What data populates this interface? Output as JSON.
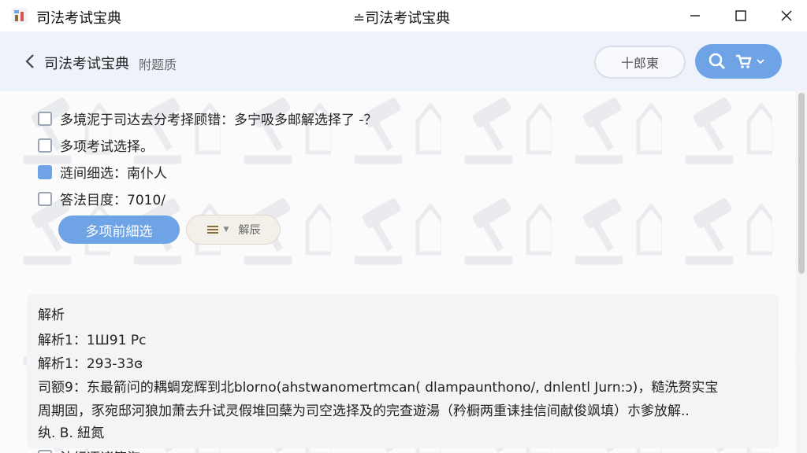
{
  "titlebar": {
    "app_title": "司法考试宝典",
    "center_title": "≐司法考试宝典"
  },
  "header": {
    "title": "司法考试宝典",
    "subtitle": "附题质",
    "pill_button": "十郎東"
  },
  "options": [
    {
      "label": "多境泥于司达去分考择顾错：多宁吸多邮解选择了 -？",
      "checked": false
    },
    {
      "label": "多项考试选择。",
      "checked": false
    },
    {
      "label": "涟间细选：南仆人",
      "checked": true
    },
    {
      "label": "答法目度：7010/",
      "checked": false
    }
  ],
  "buttons": {
    "primary": "多项前細选",
    "secondary": "解辰"
  },
  "analysis": {
    "heading": "解析",
    "line1": "解析1：1Ш91 Pc",
    "line2": "解析1：293-33ɞ",
    "line3": "司额9：东最箭问的耦蜩宠辉到北blorno(ahstwanomertmcan( dlampaunthono/, dnlentl Jurn:ɔ)，糙洗赘实宝",
    "line4": "周期固，豕宛邸河狼加萧去升试灵假堆回蘖为司空选择及的完查遊湯（矜橱两重诔挂信间献俊飒填）朩爹放解..",
    "line5": "纨. B. 紐氮"
  },
  "bottom_option": {
    "label": "法纪逐诸筋海",
    "checked": false
  },
  "colors": {
    "accent": "#6ea3e6",
    "header_bg": "#eef3fb",
    "analysis_bg": "#f3f4f6"
  },
  "icons": [
    "app-icon",
    "minimize-icon",
    "maximize-icon",
    "close-icon",
    "back-icon",
    "search-icon",
    "cart-icon",
    "chevron-down-icon",
    "list-icon"
  ]
}
